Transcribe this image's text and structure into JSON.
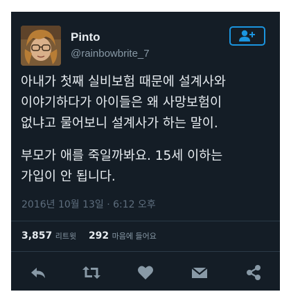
{
  "user": {
    "display_name": "Pinto",
    "handle": "@rainbowbrite_7"
  },
  "tweet": {
    "lines": [
      "아내가 첫째 실비보험 때문에 설계사와",
      "이야기하다가 아이들은 왜 사망보험이",
      "없냐고 물어보니 설계사가 하는 말이.",
      "부모가 애를 죽일까봐요. 15세 이하는",
      "가입이 안 됩니다."
    ],
    "timestamp": "2016년 10월 13일 · 6:12 오후"
  },
  "stats": {
    "retweets_count": "3,857",
    "retweets_label": "리트윗",
    "likes_count": "292",
    "likes_label": "마음에 들어요"
  },
  "icons": {
    "follow": "add-user-icon",
    "reply": "reply-icon",
    "retweet": "retweet-icon",
    "like": "heart-icon",
    "message": "envelope-icon",
    "share": "share-icon"
  },
  "colors": {
    "background": "#141d26",
    "accent": "#1b95e0",
    "text": "#e7ecf0",
    "muted": "#8899a6",
    "icon": "#8899a6"
  }
}
